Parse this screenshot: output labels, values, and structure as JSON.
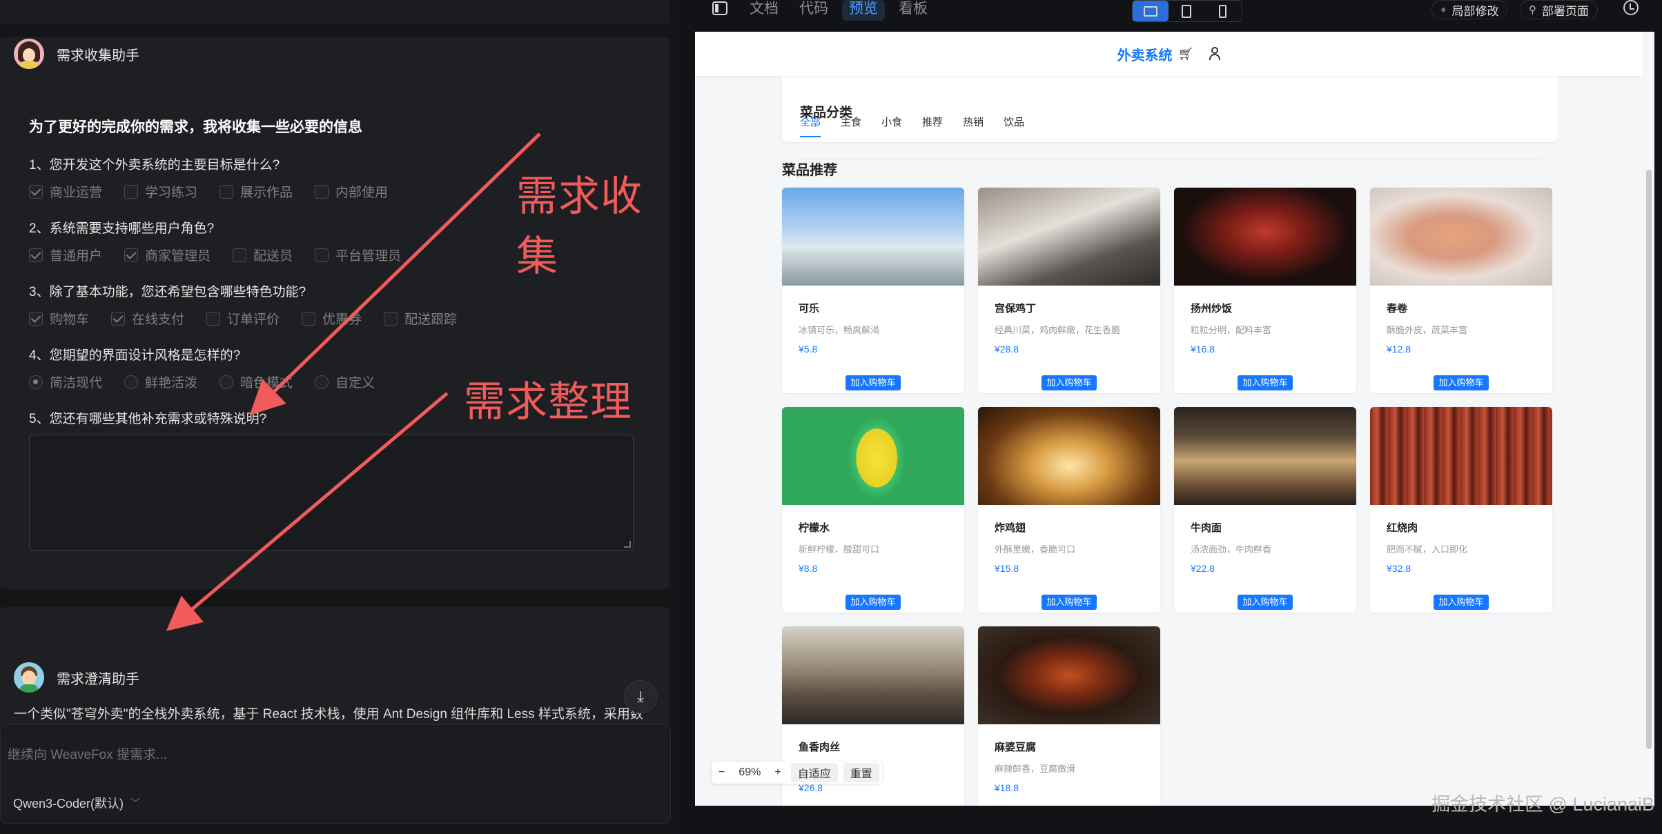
{
  "collect_agent": {
    "name": "需求收集助手"
  },
  "form": {
    "intro": "为了更好的完成你的需求，我将收集一些必要的信息",
    "questions": [
      {
        "text": "1、您开发这个外卖系统的主要目标是什么?",
        "options": [
          "商业运营",
          "学习练习",
          "展示作品",
          "内部使用"
        ],
        "checked": [
          true,
          false,
          false,
          false
        ]
      },
      {
        "text": "2、系统需要支持哪些用户角色?",
        "options": [
          "普通用户",
          "商家管理员",
          "配送员",
          "平台管理员"
        ],
        "checked": [
          true,
          true,
          false,
          false
        ]
      },
      {
        "text": "3、除了基本功能，您还希望包含哪些特色功能?",
        "options": [
          "购物车",
          "在线支付",
          "订单评价",
          "优惠券",
          "配送跟踪"
        ],
        "checked": [
          true,
          true,
          false,
          false,
          false
        ]
      },
      {
        "text": "4、您期望的界面设计风格是怎样的?",
        "options": [
          "简洁现代",
          "鲜艳活泼",
          "暗色模式",
          "自定义"
        ],
        "checked": [
          true,
          false,
          false,
          false
        ]
      },
      {
        "text": "5、您还有哪些其他补充需求或特殊说明?"
      }
    ]
  },
  "clarify_agent": {
    "name": "需求澄清助手",
    "text": "一个类似\"苍穹外卖\"的全栈外卖系统，基于 React 技术栈，使用 Ant Design 组件库和 Less 样式系统，采用数据库存储数据，面向商业运营目标，支持普通用户和商家管理员两种角色，具备用户点餐、购物车、在线支付、商家后台管理，还能支持订单和菜品分类等核心功能，界面设计风格为简洁现代。"
  },
  "composer": {
    "placeholder": "继续向 WeaveFox 提需求...",
    "model": "Qwen3-Coder(默认)"
  },
  "annotations": {
    "collect": "需求收集",
    "organize": "需求整理"
  },
  "topbar": {
    "tabs": [
      "文档",
      "代码",
      "预览",
      "看板"
    ],
    "active_tab": "预览",
    "partial_edit": "局部修改",
    "deploy": "部署页面"
  },
  "site": {
    "logo": "外卖系统",
    "category_title": "菜品分类",
    "categories": [
      "全部",
      "主食",
      "小食",
      "推荐",
      "热销",
      "饮品"
    ],
    "active_category": "全部",
    "recommend_title": "菜品推荐",
    "add_cart_label": "加入购物车",
    "dishes": [
      {
        "name": "可乐",
        "desc": "冰镇可乐，畅爽解渴",
        "price": "¥5.8"
      },
      {
        "name": "宫保鸡丁",
        "desc": "经典川菜，鸡肉鲜嫩，花生香脆",
        "price": "¥28.8"
      },
      {
        "name": "扬州炒饭",
        "desc": "粒粒分明，配料丰富",
        "price": "¥16.8"
      },
      {
        "name": "春卷",
        "desc": "酥脆外皮，蔬菜丰富",
        "price": "¥12.8"
      },
      {
        "name": "柠檬水",
        "desc": "新鲜柠檬，酸甜可口",
        "price": "¥8.8"
      },
      {
        "name": "炸鸡翅",
        "desc": "外酥里嫩，香脆可口",
        "price": "¥15.8"
      },
      {
        "name": "牛肉面",
        "desc": "汤浓面劲，牛肉鲜香",
        "price": "¥22.8"
      },
      {
        "name": "红烧肉",
        "desc": "肥而不腻，入口即化",
        "price": "¥32.8"
      },
      {
        "name": "鱼香肉丝",
        "desc": "",
        "price": "¥26.8"
      },
      {
        "name": "麻婆豆腐",
        "desc": "麻辣鲜香，豆腐嫩滑",
        "price": "¥18.8"
      }
    ]
  },
  "zoom": {
    "minus": "−",
    "value": "69%",
    "plus": "+",
    "fit": "自适应",
    "reset": "重置"
  },
  "watermark": "掘金技术社区 @ LucianaiB"
}
